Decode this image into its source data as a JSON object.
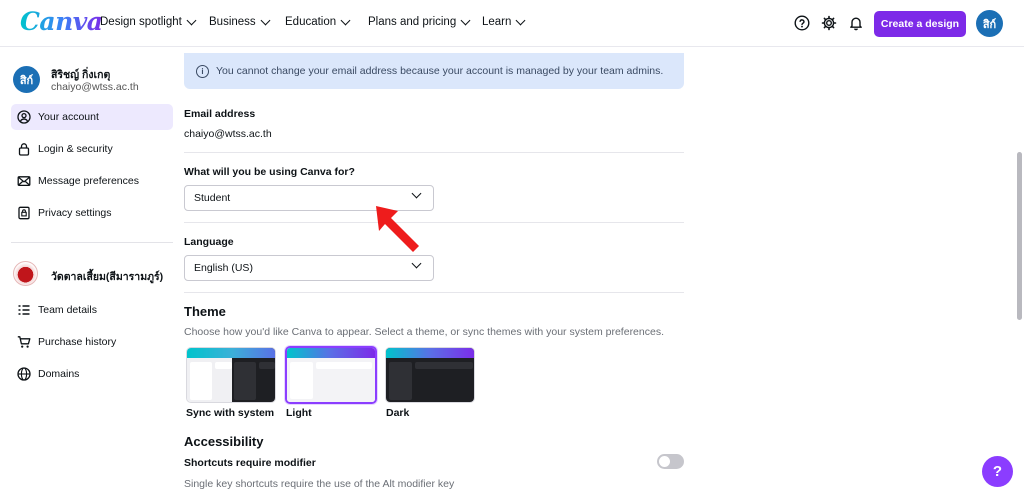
{
  "brand": {
    "logo": "Canva",
    "accent": "#7d2ae8"
  },
  "nav": {
    "items": [
      {
        "label": "Design spotlight"
      },
      {
        "label": "Business"
      },
      {
        "label": "Education"
      },
      {
        "label": "Plans and pricing"
      },
      {
        "label": "Learn"
      }
    ],
    "create_label": "Create a design",
    "avatar_initials": "สิก์"
  },
  "sidebar": {
    "user_initials": "สิก์",
    "user_name": "สิริชญ์ กิ่งเกตุ",
    "user_email": "chaiyo@wtss.ac.th",
    "items": [
      {
        "label": "Your account",
        "icon": "user-circle-icon",
        "active": true
      },
      {
        "label": "Login & security",
        "icon": "lock-icon"
      },
      {
        "label": "Message preferences",
        "icon": "envelope-icon"
      },
      {
        "label": "Privacy settings",
        "icon": "shield-lock-icon"
      }
    ],
    "team_name": "วัดตาลเสี้ยม(สีมารามภูร์)",
    "team_items": [
      {
        "label": "Team details",
        "icon": "list-icon"
      },
      {
        "label": "Purchase history",
        "icon": "cart-icon"
      },
      {
        "label": "Domains",
        "icon": "globe-icon"
      }
    ]
  },
  "main": {
    "banner_text": "You cannot change your email address because your account is managed by your team admins.",
    "email_label": "Email address",
    "email_value": "chaiyo@wtss.ac.th",
    "usage_label": "What will you be using Canva for?",
    "usage_value": "Student",
    "language_label": "Language",
    "language_value": "English (US)",
    "theme_title": "Theme",
    "theme_desc": "Choose how you'd like Canva to appear. Select a theme, or sync themes with your system preferences.",
    "themes": [
      {
        "label": "Sync with system"
      },
      {
        "label": "Light",
        "selected": true
      },
      {
        "label": "Dark"
      }
    ],
    "accessibility_title": "Accessibility",
    "shortcuts_label": "Shortcuts require modifier",
    "shortcuts_desc": "Single key shortcuts require the use of the Alt modifier key",
    "shortcuts_enabled": false
  },
  "help_fab": "?"
}
